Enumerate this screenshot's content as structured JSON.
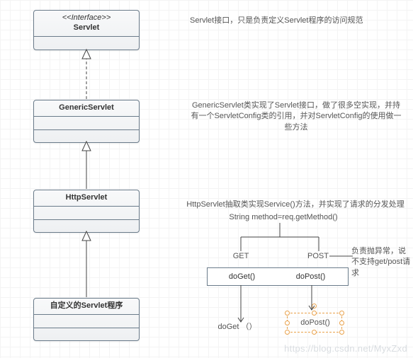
{
  "classes": {
    "servlet": {
      "stereotype": "<<Interface>>",
      "name": "Servlet"
    },
    "generic": {
      "name": "GenericServlet"
    },
    "http": {
      "name": "HttpServlet"
    },
    "custom": {
      "name": "自定义的Servlet程序"
    }
  },
  "notes": {
    "n1": "Servlet接口，只是负责定义Servlet程序的访问规范",
    "n2": "GenericServlet类实现了Servlet接口，做了很多空实现，并持有一个ServletConfig类的引用，并对ServletConfig的使用做一些方法",
    "n3line1": "HttpServlet抽取类实现Service()方法，并实现了请求的分发处理",
    "n3line2": "String method=req.getMethod()",
    "branchGet": "GET",
    "branchPost": "POST",
    "errNote": "负责抛异常，说不支持get/post请求",
    "methodGet": "doGet()",
    "methodPost": "doPost()",
    "ovGet": "doGet （）",
    "ovPost": "doPost()"
  },
  "watermark": "https://blog.csdn.net/MyxZxd"
}
